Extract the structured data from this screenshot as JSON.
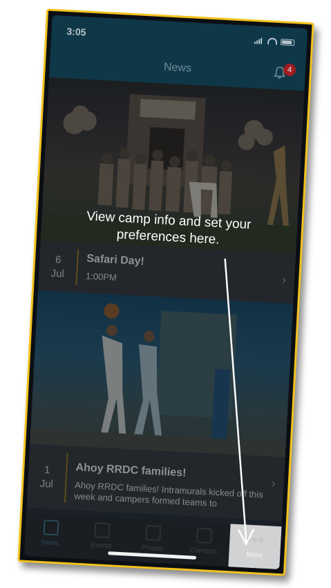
{
  "status_bar": {
    "time": "3:05"
  },
  "header": {
    "title": "News",
    "notification_count": "4"
  },
  "news": [
    {
      "day": "6",
      "month": "Jul",
      "title": "Safari Day!",
      "subtitle": "1:00PM"
    },
    {
      "day": "1",
      "month": "Jul",
      "title": "Ahoy RRDC families!",
      "snippet": "Ahoy RRDC families!  Intramurals kicked off this week and campers formed teams to"
    }
  ],
  "tab_bar": {
    "tabs": [
      {
        "label": "News",
        "icon": "news-icon"
      },
      {
        "label": "Events",
        "icon": "calendar-icon"
      },
      {
        "label": "Photos",
        "icon": "photos-icon"
      },
      {
        "label": "Contacts",
        "icon": "contacts-icon"
      },
      {
        "label": "More",
        "icon": "more-dots-icon"
      }
    ]
  },
  "coach_mark": {
    "text": "View camp info and set your preferences here."
  },
  "colors": {
    "frame": "#f3c21b",
    "header": "#0e3848",
    "badge": "#a01d22"
  }
}
